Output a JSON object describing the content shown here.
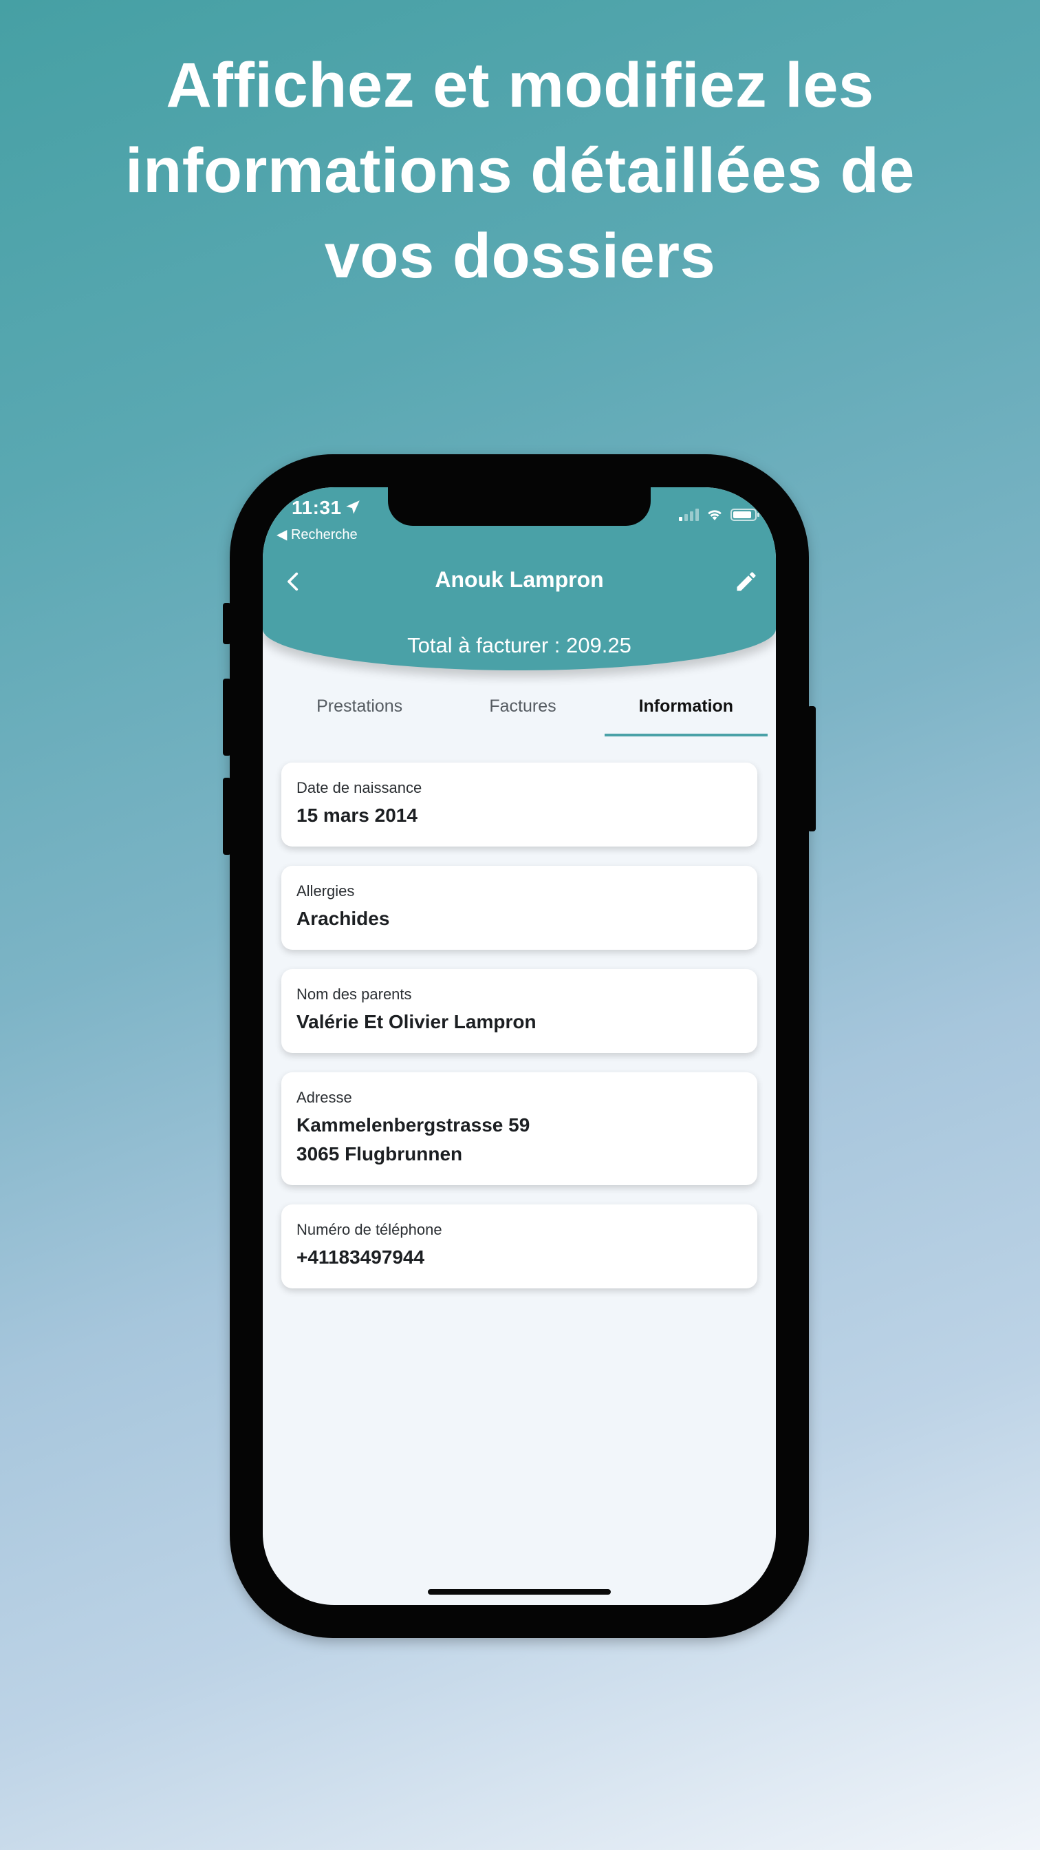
{
  "headline": {
    "line1": "Affichez et modifiez les",
    "line2": "informations détaillées de",
    "line3": "vos dossiers"
  },
  "status_bar": {
    "time": "11:31",
    "back_app": "◀ Recherche"
  },
  "header": {
    "title": "Anouk Lampron",
    "total": "Total à facturer : 209.25"
  },
  "tabs": [
    {
      "label": "Prestations",
      "active": false
    },
    {
      "label": "Factures",
      "active": false
    },
    {
      "label": "Information",
      "active": true
    }
  ],
  "info_cards": [
    {
      "label": "Date de naissance",
      "value": "15 mars 2014"
    },
    {
      "label": "Allergies",
      "value": "Arachides"
    },
    {
      "label": "Nom des parents",
      "value": "Valérie Et Olivier Lampron"
    },
    {
      "label": "Adresse",
      "value": "Kammelenbergstrasse 59",
      "value_line2": "3065 Flugbrunnen"
    },
    {
      "label": "Numéro de téléphone",
      "value": "+41183497944"
    }
  ],
  "colors": {
    "accent": "#4aa1a7",
    "screen_background": "#f2f6fa",
    "card_background": "#ffffff"
  },
  "icons": {
    "back": "chevron-left-icon",
    "edit": "pencil-icon",
    "location": "location-arrow-icon",
    "signal": "signal-icon",
    "wifi": "wifi-icon",
    "battery": "battery-icon"
  }
}
